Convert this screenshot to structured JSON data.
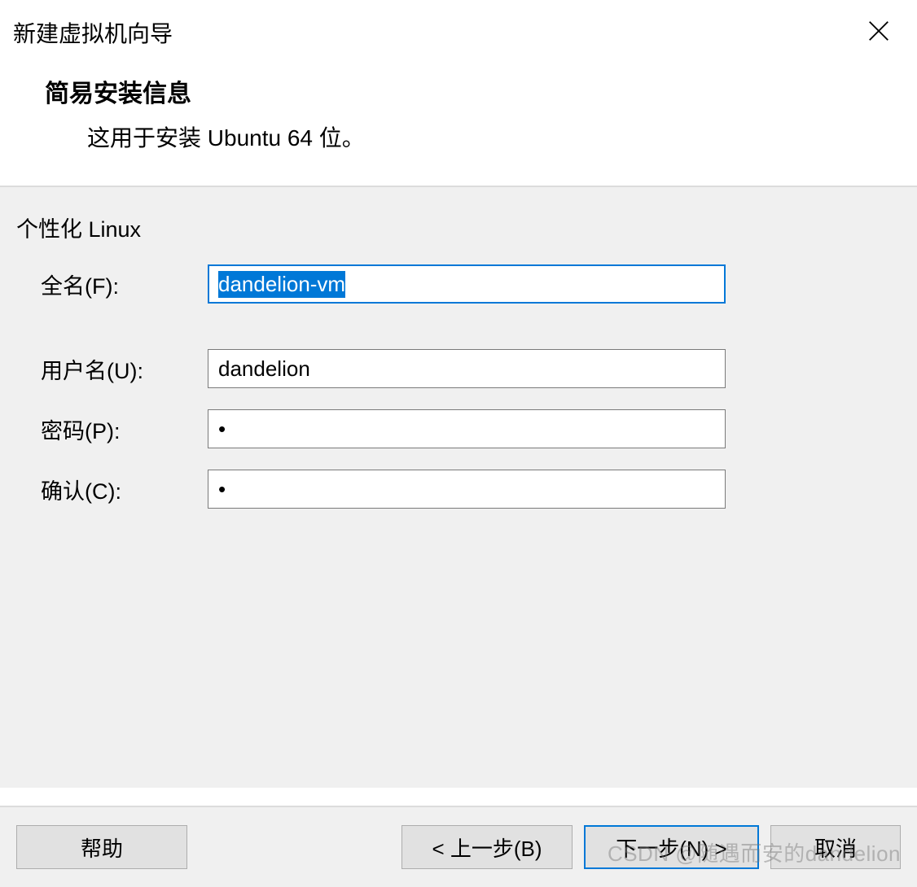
{
  "window": {
    "title": "新建虚拟机向导"
  },
  "header": {
    "title": "简易安装信息",
    "subtitle": "这用于安装 Ubuntu 64 位。"
  },
  "section": {
    "label": "个性化 Linux"
  },
  "form": {
    "fullname": {
      "label": "全名(F):",
      "value": "dandelion-vm"
    },
    "username": {
      "label": "用户名(U):",
      "value": "dandelion"
    },
    "password": {
      "label": "密码(P):",
      "value": "•"
    },
    "confirm": {
      "label": "确认(C):",
      "value": "•"
    }
  },
  "footer": {
    "help": "帮助",
    "back": "< 上一步(B)",
    "next": "下一步(N) >",
    "cancel": "取消"
  },
  "watermark": "CSDN @随遇而安的dandelion"
}
